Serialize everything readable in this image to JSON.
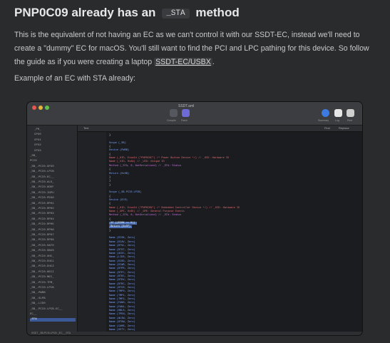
{
  "heading": {
    "prefix": "PNP0C09 already has an",
    "code": "_STA",
    "suffix": "method"
  },
  "paragraph": {
    "text_before_link": "This is the equivalent of not having an EC as we can't control it with our SSDT-EC, instead we'll need to create a \"dummy\" EC for macOS. You'll still want to find the PCI and LPC pathing for this device. So follow the guide as if you were creating a laptop ",
    "link": "SSDT-EC/USBX",
    "text_after_link": "."
  },
  "example_label": "Example of an EC with STA already:",
  "screenshot": {
    "window_title": "SSDT.aml",
    "toolbar": [
      "Compile",
      "Patch",
      "Summary",
      "Log",
      "Print"
    ],
    "editor_tab": "Text",
    "editor_right": [
      "Find",
      "Replace"
    ],
    "colors": {
      "close": "#e8574f",
      "minimize": "#e4b43a",
      "zoom": "#5fbf4a",
      "selection": "#3b5998"
    },
    "sidebar_items": [
      "_PR_",
      "CPU0",
      "CPU1",
      "CPU2",
      "CPU3",
      "_SB_",
      "PCI0",
      "_SB_.PCI0.GFX0",
      "_SB_.PCI0.LPCB",
      "_SB_.PCI0.EC__",
      "_SB_.PCI0.ALS_",
      "_SB_.PCI0.HDEF",
      "_SB_.PCI0.IGPU",
      "_SB_.PCI0.PEG0",
      "_SB_.PCI0.RP01",
      "_SB_.PCI0.RP02",
      "_SB_.PCI0.RP03",
      "_SB_.PCI0.RP04",
      "_SB_.PCI0.RP05",
      "_SB_.PCI0.RP06",
      "_SB_.PCI0.RP07",
      "_SB_.PCI0.RP08",
      "_SB_.PCI0.SAT0",
      "_SB_.PCI0.SBUS",
      "_SB_.PCI0.XHC_",
      "_SB_.PCI0.EHC1",
      "_SB_.PCI0.EHC2",
      "_SB_.PCI0.HECI",
      "_SB_.PCI0.MEI_",
      "_SB_.PCI0.TPM_",
      "_SB_.PCI0.LPCB",
      "_SB_.PWRB",
      "_SB_.SLPB",
      "_SB_.LID0",
      "_SB_.PCI0.LPCB.EC__",
      "EC__",
      "_STA"
    ],
    "code_lines": [
      {
        "t": "            }",
        "c": "txt"
      },
      {
        "t": "",
        "c": "txt"
      },
      {
        "t": "        Scope (_SB)",
        "c": "kw"
      },
      {
        "t": "        {",
        "c": "txt"
      },
      {
        "t": "            Device (PWRB)",
        "c": "kw"
      },
      {
        "t": "            {",
        "c": "txt"
      },
      {
        "t": "                Name (_HID, EisaId (\"PNP0C0C\") /* Power Button Device */)  // _HID: Hardware ID",
        "c": "str"
      },
      {
        "t": "                Name (_UID, 0xAA)  // _UID: Unique ID",
        "c": "str"
      },
      {
        "t": "                Method (_STA, 0, NotSerialized)  // _STA: Status",
        "c": "fn"
      },
      {
        "t": "                {",
        "c": "txt"
      },
      {
        "t": "                    Return (0x0B)",
        "c": "kw"
      },
      {
        "t": "                }",
        "c": "txt"
      },
      {
        "t": "            }",
        "c": "txt"
      },
      {
        "t": "        }",
        "c": "txt"
      },
      {
        "t": "",
        "c": "txt"
      },
      {
        "t": "        Scope (_SB.PCI0.LPCB)",
        "c": "kw"
      },
      {
        "t": "        {",
        "c": "txt"
      },
      {
        "t": "            Device (EC0)",
        "c": "kw"
      },
      {
        "t": "            {",
        "c": "txt"
      },
      {
        "t": "                Name (_HID, EisaId (\"PNP0C09\") /* Embedded Controller Device */)  // _HID: Hardware ID",
        "c": "str"
      },
      {
        "t": "                Name (_GPE, 0x6E)  // _GPE: General Purpose Events",
        "c": "str"
      },
      {
        "t": "                Method (_STA, 0, NotSerialized)  // _STA: Status",
        "c": "fn"
      },
      {
        "t": "                {",
        "c": "txt"
      },
      {
        "t": "                    If ((ECON == 0))",
        "c": "kw",
        "sel": true
      },
      {
        "t": "                    Return (0x0F)",
        "c": "kw",
        "sel": true
      },
      {
        "t": "                }",
        "c": "txt"
      },
      {
        "t": "",
        "c": "txt"
      },
      {
        "t": "                Name (ECOK, Zero)",
        "c": "kw"
      },
      {
        "t": "                Name (ECAV, Zero)",
        "c": "kw"
      },
      {
        "t": "                Name (BTVL, Zero)",
        "c": "kw"
      },
      {
        "t": "                Name (BTST, Zero)",
        "c": "kw"
      },
      {
        "t": "                Name (ACDC, Zero)",
        "c": "kw"
      },
      {
        "t": "                Name (LIDS, Zero)",
        "c": "kw"
      },
      {
        "t": "                Name (ECRD, Zero)",
        "c": "kw"
      },
      {
        "t": "                Name (ECWR, Zero)",
        "c": "kw"
      },
      {
        "t": "                Name (BTPR, Zero)",
        "c": "kw"
      },
      {
        "t": "                Name (BTFC, Zero)",
        "c": "kw"
      },
      {
        "t": "                Name (BTDC, Zero)",
        "c": "kw"
      },
      {
        "t": "                Name (BTDV, Zero)",
        "c": "kw"
      },
      {
        "t": "                Name (BTRC, Zero)",
        "c": "kw"
      },
      {
        "t": "                Name (BTCR, Zero)",
        "c": "kw"
      },
      {
        "t": "                Name (TMP0, Zero)",
        "c": "kw"
      },
      {
        "t": "                Name (TMP1, Zero)",
        "c": "kw"
      },
      {
        "t": "                Name (TMP2, Zero)",
        "c": "kw"
      },
      {
        "t": "                Name (FAN0, Zero)",
        "c": "kw"
      },
      {
        "t": "                Name (FAN1, Zero)",
        "c": "kw"
      },
      {
        "t": "                Name (KBLS, Zero)",
        "c": "kw"
      },
      {
        "t": "                Name (TPEN, Zero)",
        "c": "kw"
      },
      {
        "t": "                Name (WLSW, Zero)",
        "c": "kw"
      },
      {
        "t": "                Name (BTSW, Zero)",
        "c": "kw"
      },
      {
        "t": "                Name (CAMS, Zero)",
        "c": "kw"
      },
      {
        "t": "                Name (OSTY, Zero)",
        "c": "kw"
      }
    ],
    "status_text": "SSDT _SB.PCI0.LPCB _EC_ _STA"
  }
}
